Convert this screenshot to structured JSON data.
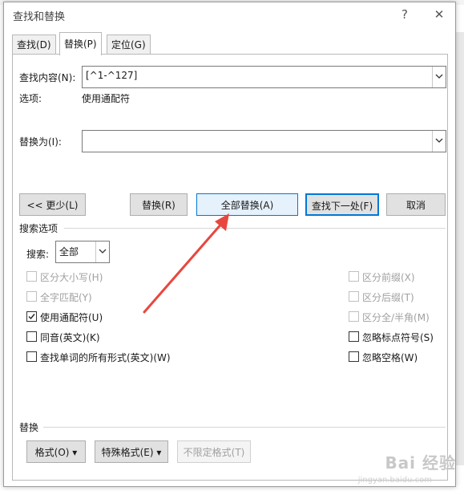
{
  "window": {
    "title": "查找和替换",
    "help": "?",
    "close": "✕"
  },
  "tabs": [
    {
      "label": "查找(D)",
      "active": false
    },
    {
      "label": "替换(P)",
      "active": true
    },
    {
      "label": "定位(G)",
      "active": false
    }
  ],
  "find": {
    "label": "查找内容(N):",
    "value": "[^1-^127]"
  },
  "options": {
    "label": "选项:",
    "value": "使用通配符"
  },
  "replace": {
    "label": "替换为(I):",
    "value": ""
  },
  "buttons": {
    "less": "<< 更少(L)",
    "replace": "替换(R)",
    "replace_all": "全部替换(A)",
    "find_next": "查找下一处(F)",
    "cancel": "取消"
  },
  "search_options": {
    "heading": "搜索选项",
    "search_label": "搜索:",
    "search_value": "全部"
  },
  "checkboxes_left": [
    {
      "label": "区分大小写(H)",
      "checked": false,
      "enabled": false
    },
    {
      "label": "全字匹配(Y)",
      "checked": false,
      "enabled": false
    },
    {
      "label": "使用通配符(U)",
      "checked": true,
      "enabled": true
    },
    {
      "label": "同音(英文)(K)",
      "checked": false,
      "enabled": true
    },
    {
      "label": "查找单词的所有形式(英文)(W)",
      "checked": false,
      "enabled": true
    }
  ],
  "checkboxes_right": [
    {
      "label": "区分前缀(X)",
      "checked": false,
      "enabled": false
    },
    {
      "label": "区分后缀(T)",
      "checked": false,
      "enabled": false
    },
    {
      "label": "区分全/半角(M)",
      "checked": false,
      "enabled": false
    },
    {
      "label": "忽略标点符号(S)",
      "checked": false,
      "enabled": true
    },
    {
      "label": "忽略空格(W)",
      "checked": false,
      "enabled": true
    }
  ],
  "replace_section": {
    "heading": "替换",
    "format": "格式(O) ▾",
    "special": "特殊格式(E) ▾",
    "no_format": "不限定格式(T)"
  },
  "watermark": {
    "text": "Bai 经验",
    "sub": "jingyan.baidu.com"
  },
  "colors": {
    "accent": "#0078d7",
    "arrow": "#e8473f"
  }
}
